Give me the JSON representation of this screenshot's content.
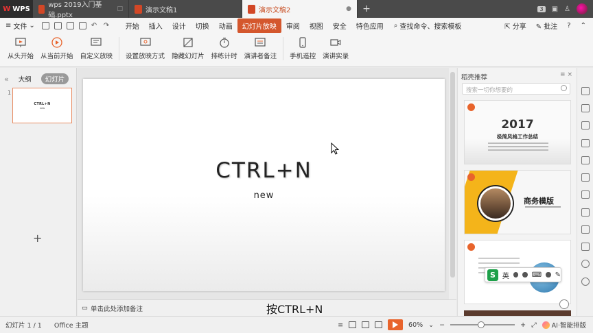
{
  "titlebar": {
    "logo": "WPS",
    "tabs": [
      {
        "label": "wps 2019入门基础.pptx",
        "close": "□"
      },
      {
        "label": "演示文稿1",
        "close": ""
      },
      {
        "label": "演示文稿2",
        "close": "●"
      }
    ],
    "plus": "+",
    "badge": "3"
  },
  "menubar": {
    "file_label": "文件",
    "items": [
      "开始",
      "插入",
      "设计",
      "切换",
      "动画",
      "幻灯片放映",
      "审阅",
      "视图",
      "安全",
      "特色应用"
    ],
    "active_item": "幻灯片放映",
    "search_label": "查找命令、搜索模板",
    "share_label": "分享",
    "comment_label": "批注",
    "help_label": "?"
  },
  "ribbon": {
    "buttons": [
      {
        "label": "从头开始",
        "icon": "slideshow-icon"
      },
      {
        "label": "从当前开始",
        "icon": "play-circle-icon"
      },
      {
        "label": "自定义放映",
        "icon": "custom-show-icon"
      },
      {
        "label": "设置放映方式",
        "icon": "settings-show-icon"
      },
      {
        "label": "隐藏幻灯片",
        "icon": "hide-slide-icon"
      },
      {
        "label": "排练计时",
        "icon": "timer-icon"
      },
      {
        "label": "演讲者备注",
        "icon": "notes-icon"
      },
      {
        "label": "手机遥控",
        "icon": "phone-icon"
      },
      {
        "label": "演讲实录",
        "icon": "camera-icon"
      }
    ]
  },
  "leftpanel": {
    "tab_outline": "大纲",
    "tab_slides": "幻灯片",
    "thumb_number": "1",
    "thumb_title": "CTRL+N",
    "thumb_sub": "new",
    "add_label": "+"
  },
  "slide": {
    "title": "CTRL+N",
    "subtitle": "new"
  },
  "notes": {
    "placeholder": "单击此处添加备注"
  },
  "video_subtitle": "按CTRL+N",
  "rightpanel": {
    "heading": "稻壳推荐",
    "search_placeholder": "搜索一切你想要的",
    "card1_year": "2017",
    "card1_title": "极简风格工作总结",
    "card2_title": "商务模版",
    "ime_label": "英",
    "ime_logo": "S"
  },
  "statusbar": {
    "slide_count": "幻灯片 1 / 1",
    "theme": "Office 主题",
    "zoom": "60%",
    "zoom_level": 0.0,
    "ai_label": "AI·智能排版",
    "minus": "−",
    "plus": "+"
  },
  "colors": {
    "accent": "#d4572d",
    "titlebar": "#4a4a4a",
    "play": "#e8642c"
  }
}
